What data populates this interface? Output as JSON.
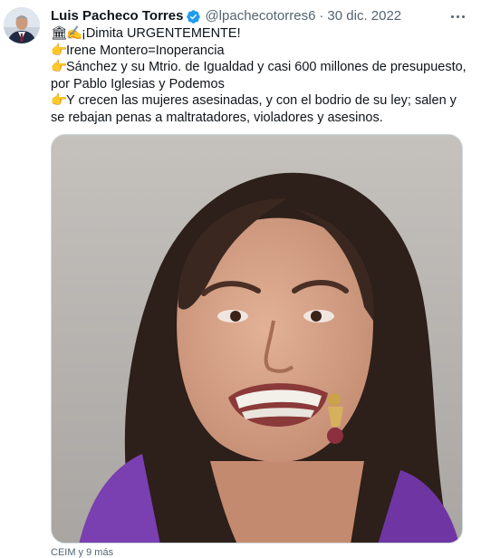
{
  "author": {
    "display_name": "Luis Pacheco Torres",
    "handle": "@lpachecotorres6",
    "separator": "·",
    "date": "30 dic. 2022"
  },
  "colors": {
    "verified_badge": "#1d9bf0",
    "handle_gray": "#536471",
    "text_primary": "#0f1419"
  },
  "icons": {
    "verified": "verified-badge-icon",
    "more": "more-options-icon",
    "line1_emojis": [
      "classical-building-emoji",
      "writing-hand-emoji"
    ],
    "bullet": "pointing-right-hand-emoji"
  },
  "emoji_glyphs": {
    "building": "🏛",
    "writing_hand": "✍",
    "pointing_right": "👉"
  },
  "tweet": {
    "line1": "¡Dimita URGENTEMENTE!",
    "line2": "Irene Montero=Inoperancia",
    "line3": "Sánchez y su Mtrio. de Igualdad y casi 600 millones de presupuesto, por Pablo Iglesias y Podemos",
    "line4": "Y crecen las mujeres asesinadas, y con el bodrio de su ley; salen y se rebajan penas a maltratadores, violadores y asesinos."
  },
  "footer": {
    "text": "CEIM y 9 más"
  }
}
